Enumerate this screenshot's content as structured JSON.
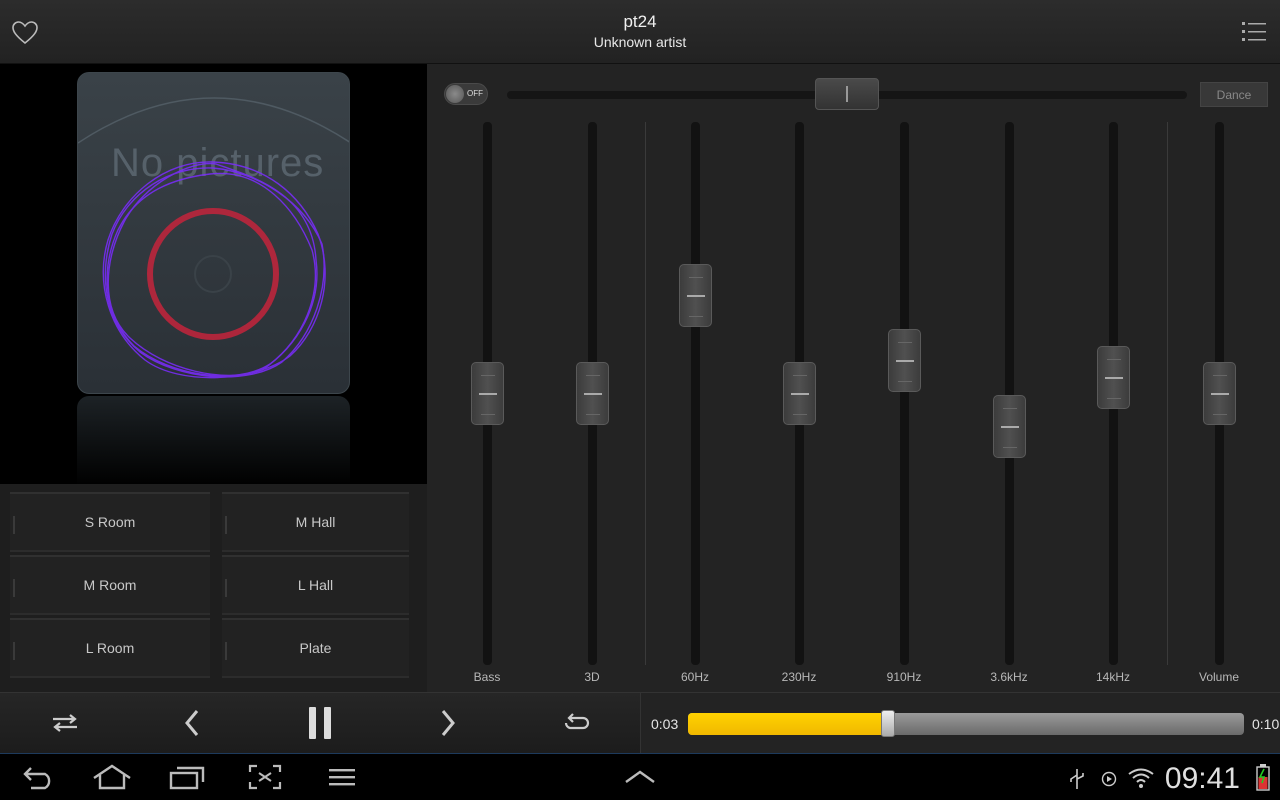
{
  "header": {
    "title": "pt24",
    "artist": "Unknown artist",
    "icons": {
      "favorite": "heart-outline-icon",
      "menu": "list-menu-icon"
    }
  },
  "album": {
    "placeholder_text": "No pictures"
  },
  "reverb_presets": [
    {
      "label": "S Room"
    },
    {
      "label": "M Hall"
    },
    {
      "label": "M Room"
    },
    {
      "label": "L Hall"
    },
    {
      "label": "L Room"
    },
    {
      "label": "Plate"
    }
  ],
  "equalizer": {
    "power_switch": {
      "label": "OFF",
      "state": "off"
    },
    "preset_name": "Dance",
    "bands": [
      {
        "label": "Bass",
        "level": 0.5
      },
      {
        "label": "3D",
        "level": 0.5
      },
      {
        "label": "60Hz",
        "level": 0.68
      },
      {
        "label": "230Hz",
        "level": 0.5
      },
      {
        "label": "910Hz",
        "level": 0.56
      },
      {
        "label": "3.6kHz",
        "level": 0.44
      },
      {
        "label": "14kHz",
        "level": 0.53
      },
      {
        "label": "Volume",
        "level": 0.5
      }
    ]
  },
  "playback": {
    "current_time": "0:03",
    "total_time": "0:10",
    "progress": 0.36,
    "icons": [
      "shuffle-icon",
      "previous-icon",
      "pause-icon",
      "next-icon",
      "repeat-icon"
    ]
  },
  "system_bar": {
    "clock": "09:41",
    "icons": [
      "back-icon",
      "home-icon",
      "recent-apps-icon",
      "screenshot-icon",
      "menu-icon",
      "expand-up-icon",
      "usb-icon",
      "play-status-icon",
      "wifi-icon",
      "battery-icon"
    ]
  },
  "colors": {
    "accent": "#f5c400",
    "visualizer": "#7b2cff",
    "ring": "#c4243c"
  }
}
